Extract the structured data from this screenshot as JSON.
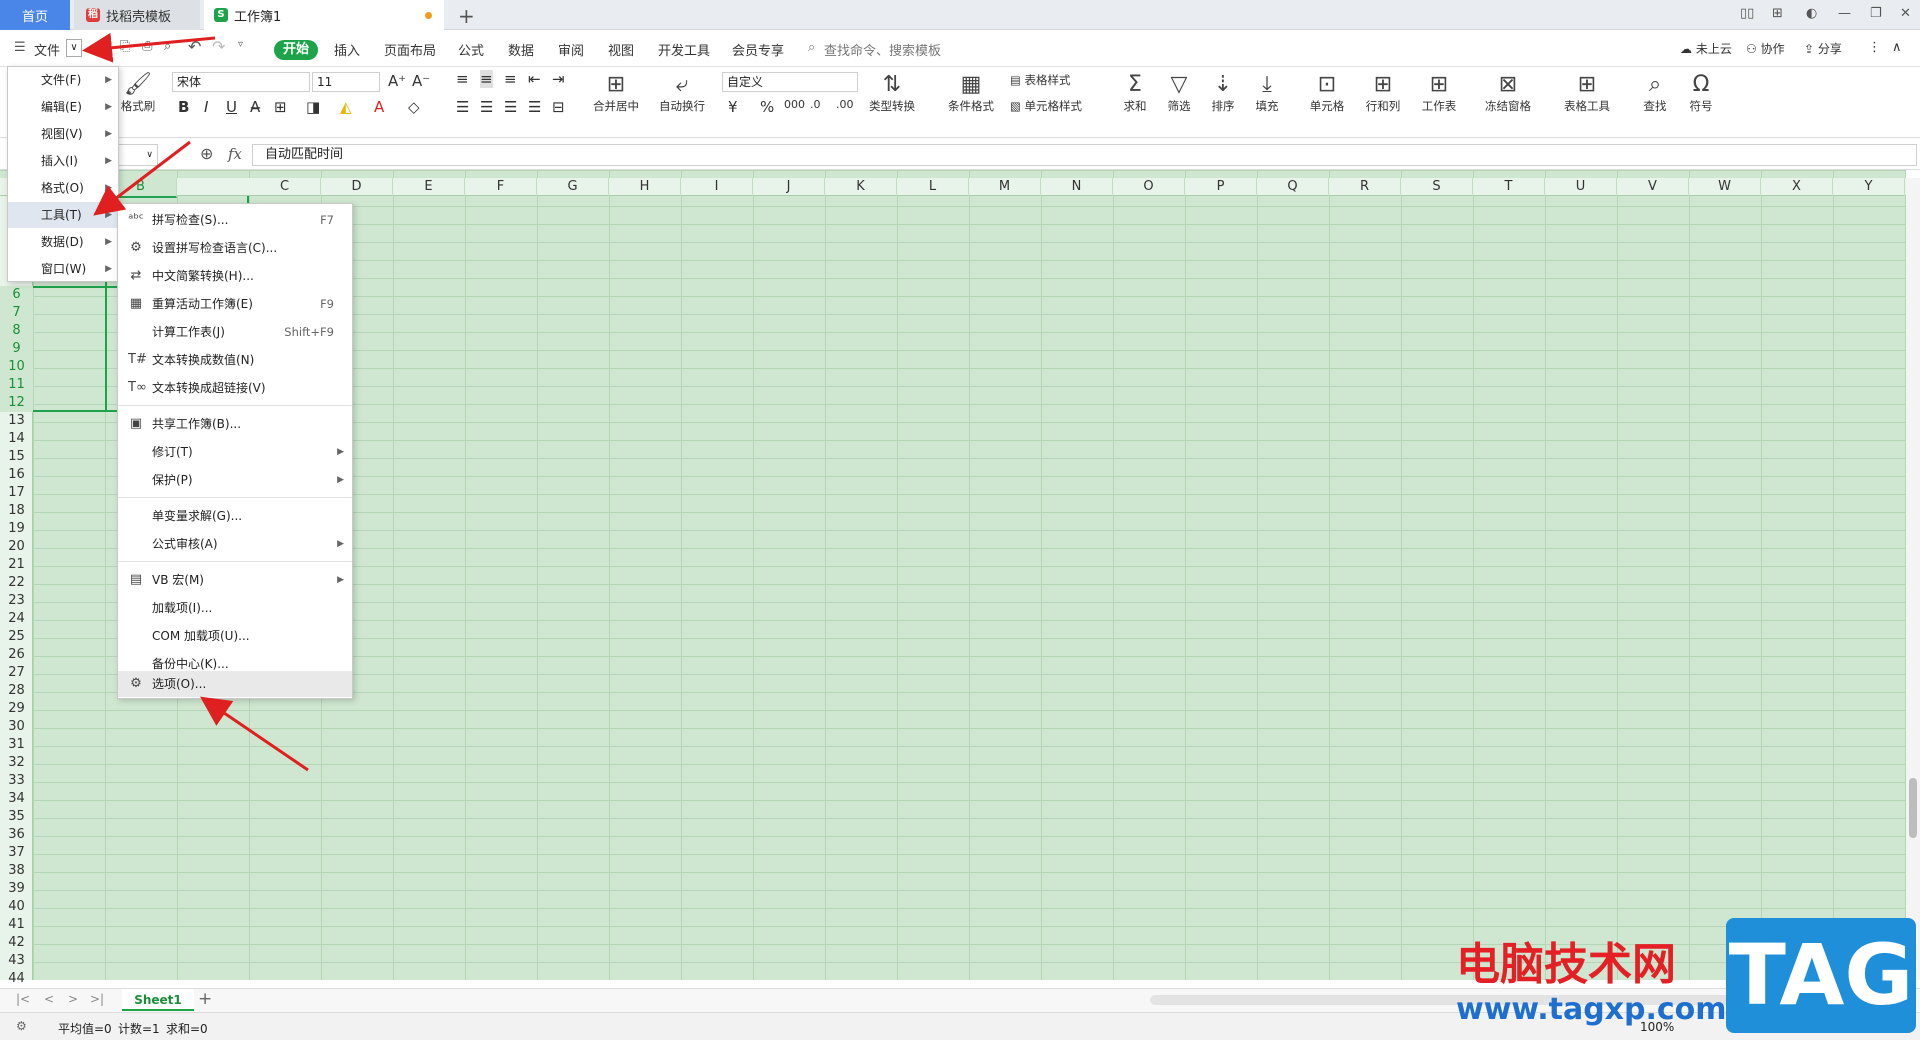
{
  "tabs": {
    "home": "首页",
    "template": "找稻壳模板",
    "workbook": "工作簿1"
  },
  "menubar": {
    "file": "文件",
    "tabs": [
      "开始",
      "插入",
      "页面布局",
      "公式",
      "数据",
      "审阅",
      "视图",
      "开发工具",
      "会员专享"
    ],
    "search": "查找命令、搜索模板",
    "cloud": "未上云",
    "collab": "协作",
    "share": "分享"
  },
  "ribbon": {
    "format_brush": "格式刷",
    "font": "宋体",
    "size": "11",
    "merge": "合并居中",
    "wrap": "自动换行",
    "numfmt": "自定义",
    "convert": "类型转换",
    "cond": "条件格式",
    "tblstyle": "表格样式",
    "cellstyle": "单元格样式",
    "sum": "求和",
    "filter": "筛选",
    "sort": "排序",
    "fill": "填充",
    "cell": "单元格",
    "rowcol": "行和列",
    "sheet": "工作表",
    "freeze": "冻结窗格",
    "tbltools": "表格工具",
    "find": "查找",
    "symbol": "符号"
  },
  "formula": {
    "fx": "fx",
    "value": "自动匹配时间"
  },
  "columns": [
    "B",
    "C",
    "D",
    "E",
    "F",
    "G",
    "H",
    "I",
    "J",
    "K",
    "L",
    "M",
    "N",
    "O",
    "P",
    "Q",
    "R",
    "S",
    "T",
    "U",
    "V",
    "W",
    "X",
    "Y"
  ],
  "rows": [
    "6",
    "7",
    "8",
    "9",
    "10",
    "11",
    "12",
    "13",
    "14",
    "15",
    "16",
    "17",
    "18",
    "19",
    "20",
    "21",
    "22",
    "23",
    "24",
    "25",
    "26",
    "27",
    "28",
    "29",
    "30",
    "31",
    "32",
    "33",
    "34",
    "35",
    "36",
    "37",
    "38",
    "39",
    "40",
    "41",
    "42",
    "43",
    "44"
  ],
  "file_menu": [
    {
      "label": "文件(F)"
    },
    {
      "label": "编辑(E)"
    },
    {
      "label": "视图(V)"
    },
    {
      "label": "插入(I)"
    },
    {
      "label": "格式(O)"
    },
    {
      "label": "工具(T)"
    },
    {
      "label": "数据(D)"
    },
    {
      "label": "窗口(W)"
    }
  ],
  "tools_menu": [
    {
      "icon": "ᵃᵇᶜ",
      "label": "拼写检查(S)...",
      "shortcut": "F7"
    },
    {
      "icon": "⚙",
      "label": "设置拼写检查语言(C)...",
      "shortcut": ""
    },
    {
      "icon": "⇄",
      "label": "中文简繁转换(H)...",
      "shortcut": ""
    },
    {
      "icon": "▦",
      "label": "重算活动工作簿(E)",
      "shortcut": "F9"
    },
    {
      "icon": "",
      "label": "计算工作表(J)",
      "shortcut": "Shift+F9"
    },
    {
      "icon": "T#",
      "label": "文本转换成数值(N)",
      "shortcut": ""
    },
    {
      "icon": "T∞",
      "label": "文本转换成超链接(V)",
      "shortcut": ""
    },
    {
      "icon": "▣",
      "label": "共享工作簿(B)...",
      "shortcut": ""
    },
    {
      "icon": "",
      "label": "修订(T)",
      "shortcut": ""
    },
    {
      "icon": "",
      "label": "保护(P)",
      "shortcut": ""
    },
    {
      "icon": "",
      "label": "单变量求解(G)...",
      "shortcut": ""
    },
    {
      "icon": "",
      "label": "公式审核(A)",
      "shortcut": ""
    },
    {
      "icon": "▤",
      "label": "VB 宏(M)",
      "shortcut": ""
    },
    {
      "icon": "",
      "label": "加载项(I)...",
      "shortcut": ""
    },
    {
      "icon": "",
      "label": "COM 加载项(U)...",
      "shortcut": ""
    },
    {
      "icon": "",
      "label": "备份中心(K)...",
      "shortcut": ""
    },
    {
      "icon": "⚙",
      "label": "选项(O)...",
      "shortcut": ""
    }
  ],
  "sheet": {
    "name": "Sheet1"
  },
  "status": {
    "avg": "平均值=0",
    "count": "计数=1",
    "sum": "求和=0",
    "zoom": "100%"
  },
  "watermark": {
    "cn": "电脑技术网",
    "url": "www.tagxp.com",
    "tag": "TAG"
  },
  "colors": {
    "accent": "#1da44a",
    "grid": "#cfe7d0",
    "arrow": "#e02020"
  }
}
